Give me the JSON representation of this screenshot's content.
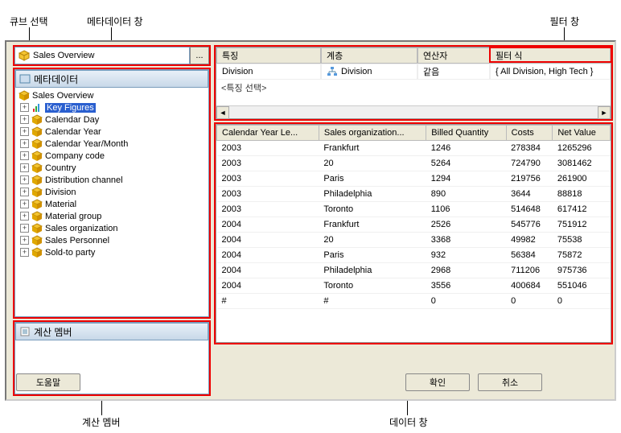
{
  "labels": {
    "cube_select": "큐브 선택",
    "metadata_pane": "메타데이터 창",
    "filter_pane": "필터 창",
    "calc_member": "계산 멤버",
    "data_pane": "데이터 창"
  },
  "cube": {
    "name": "Sales Overview",
    "browse": "..."
  },
  "metadata": {
    "title": "메타데이터",
    "root": "Sales Overview",
    "nodes": [
      {
        "label": "Key Figures",
        "expanded": false,
        "selected": true,
        "icon": "bars"
      },
      {
        "label": "Calendar Day",
        "expanded": false,
        "icon": "dim"
      },
      {
        "label": "Calendar Year",
        "expanded": false,
        "icon": "dim"
      },
      {
        "label": "Calendar Year/Month",
        "expanded": false,
        "icon": "dim"
      },
      {
        "label": "Company code",
        "expanded": false,
        "icon": "dim"
      },
      {
        "label": "Country",
        "expanded": false,
        "icon": "dim"
      },
      {
        "label": "Distribution channel",
        "expanded": false,
        "icon": "dim"
      },
      {
        "label": "Division",
        "expanded": false,
        "icon": "dim"
      },
      {
        "label": "Material",
        "expanded": false,
        "icon": "dim"
      },
      {
        "label": "Material group",
        "expanded": false,
        "icon": "dim"
      },
      {
        "label": "Sales organization",
        "expanded": false,
        "icon": "dim"
      },
      {
        "label": "Sales Personnel",
        "expanded": false,
        "icon": "dim"
      },
      {
        "label": "Sold-to party",
        "expanded": false,
        "icon": "dim"
      }
    ]
  },
  "calc": {
    "title": "계산 멤버"
  },
  "filter": {
    "headers": [
      "특징",
      "계층",
      "연산자",
      "필터 식"
    ],
    "row": {
      "feature": "Division",
      "hierarchy": "Division",
      "operator": "같음",
      "expr": "{ All Division, High Tech }"
    },
    "placeholder": "<특징 선택>"
  },
  "data": {
    "columns": [
      "Calendar Year Le...",
      "Sales organization...",
      "Billed Quantity",
      "Costs",
      "Net Value"
    ],
    "rows": [
      [
        "2003",
        "Frankfurt",
        "1246",
        "278384",
        "1265296"
      ],
      [
        "2003",
        "20",
        "5264",
        "724790",
        "3081462"
      ],
      [
        "2003",
        "Paris",
        "1294",
        "219756",
        "261900"
      ],
      [
        "2003",
        "Philadelphia",
        "890",
        "3644",
        "88818"
      ],
      [
        "2003",
        "Toronto",
        "1106",
        "514648",
        "617412"
      ],
      [
        "2004",
        "Frankfurt",
        "2526",
        "545776",
        "751912"
      ],
      [
        "2004",
        "20",
        "3368",
        "49982",
        "75538"
      ],
      [
        "2004",
        "Paris",
        "932",
        "56384",
        "75872"
      ],
      [
        "2004",
        "Philadelphia",
        "2968",
        "711206",
        "975736"
      ],
      [
        "2004",
        "Toronto",
        "3556",
        "400684",
        "551046"
      ],
      [
        "#",
        "#",
        "0",
        "0",
        "0"
      ]
    ]
  },
  "buttons": {
    "help": "도움말",
    "ok": "확인",
    "cancel": "취소"
  }
}
